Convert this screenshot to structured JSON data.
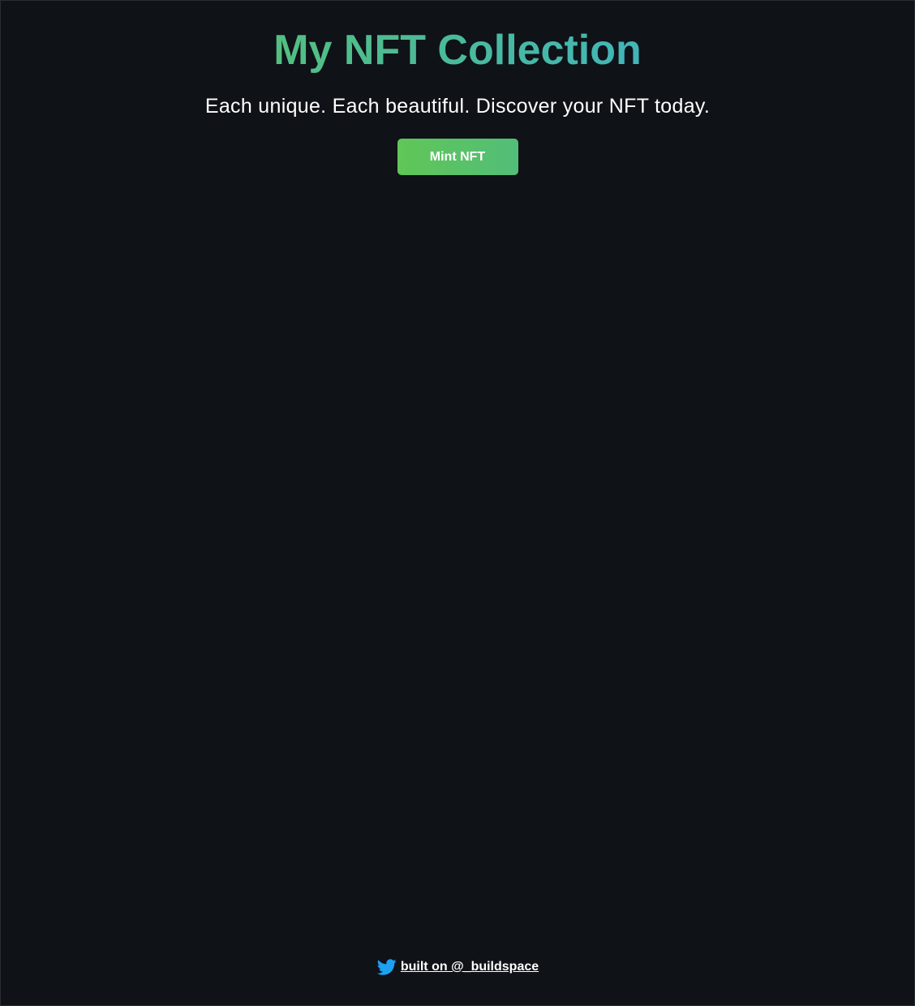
{
  "header": {
    "title": "My NFT Collection",
    "subtitle": "Each unique. Each beautiful. Discover your NFT today."
  },
  "actions": {
    "mint_label": "Mint NFT"
  },
  "footer": {
    "icon": "twitter-icon",
    "link_text": "built on @_buildspace"
  },
  "colors": {
    "background": "#0f1217",
    "gradient_start": "#60c657",
    "gradient_end": "#35aee2",
    "twitter_blue": "#1da1f2"
  }
}
